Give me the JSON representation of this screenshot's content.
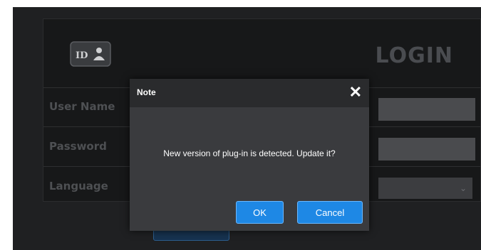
{
  "login": {
    "title": "LOGIN",
    "icon_text": "ID",
    "fields": [
      {
        "label": "User Name",
        "value": ""
      },
      {
        "label": "Password",
        "value": ""
      },
      {
        "label": "Language",
        "value": ""
      }
    ]
  },
  "dialog": {
    "title": "Note",
    "close_glyph": "✕",
    "message": "New version of plug-in is detected. Update it?",
    "ok_label": "OK",
    "cancel_label": "Cancel"
  },
  "colors": {
    "accent": "#1e88e5",
    "background": "#1f2022",
    "dialog_body": "#3a3b3e"
  }
}
